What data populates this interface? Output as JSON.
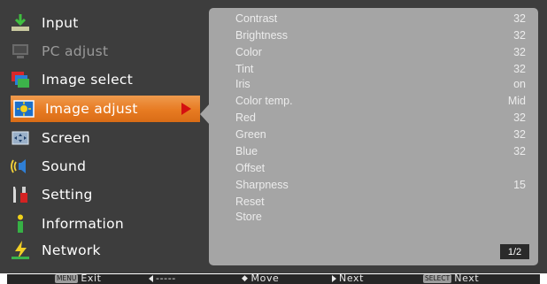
{
  "sidebar": {
    "items": [
      {
        "label": "Input",
        "icon": "input-icon"
      },
      {
        "label": "PC adjust",
        "icon": "pc-adjust-icon"
      },
      {
        "label": "Image select",
        "icon": "image-select-icon"
      },
      {
        "label": "Image adjust",
        "icon": "image-adjust-icon"
      },
      {
        "label": "Screen",
        "icon": "screen-icon"
      },
      {
        "label": "Sound",
        "icon": "sound-icon"
      },
      {
        "label": "Setting",
        "icon": "setting-icon"
      },
      {
        "label": "Information",
        "icon": "information-icon"
      },
      {
        "label": "Network",
        "icon": "network-icon"
      }
    ],
    "selected": "Image adjust",
    "disabled": "PC adjust"
  },
  "panel": {
    "rows": [
      {
        "name": "Contrast",
        "value": "32"
      },
      {
        "name": "Brightness",
        "value": "32"
      },
      {
        "name": "Color",
        "value": "32"
      },
      {
        "name": "Tint",
        "value": "32"
      },
      {
        "name": "Iris",
        "value": "on"
      },
      {
        "name": "Color temp.",
        "value": "Mid"
      },
      {
        "name": "Red",
        "value": "32"
      },
      {
        "name": "Green",
        "value": "32"
      },
      {
        "name": "Blue",
        "value": "32"
      },
      {
        "name": "Offset",
        "value": ""
      },
      {
        "name": "Sharpness",
        "value": "15"
      },
      {
        "name": "Reset",
        "value": ""
      },
      {
        "name": "Store",
        "value": ""
      }
    ],
    "page": "1/2"
  },
  "footer": {
    "menu_key": "MENU",
    "exit_label": "Exit",
    "back_label": "-----",
    "move_label": "Move",
    "next_label": "Next",
    "select_key": "SELECT",
    "select_next_label": "Next"
  },
  "colors": {
    "frame": "#3d3d3d",
    "panel": "#a5a5a5",
    "selected": "#e77b22",
    "arrow": "#d41010"
  }
}
